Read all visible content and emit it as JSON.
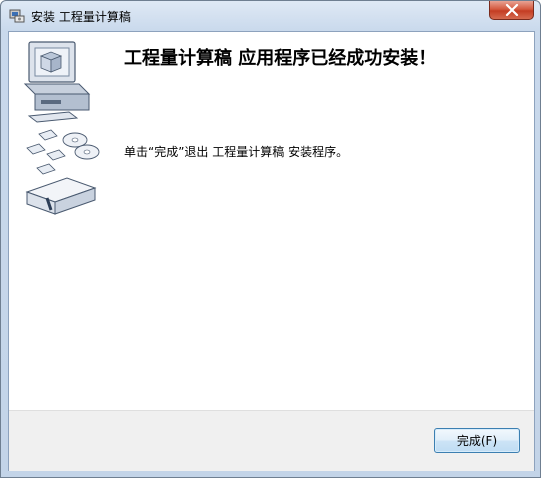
{
  "window": {
    "title": "安装 工程量计算稿"
  },
  "content": {
    "heading": "工程量计算稿 应用程序已经成功安装！",
    "message": "单击“完成”退出 工程量计算稿 安装程序。"
  },
  "buttons": {
    "finish_label": "完成(F)"
  },
  "icons": {
    "app": "installer-icon",
    "close": "close-icon",
    "graphic": "computer-with-disks-illustration"
  },
  "colors": {
    "close_button": "#c43d23",
    "button_border": "#3c7fb1",
    "footer_bg": "#f0f0f0"
  }
}
